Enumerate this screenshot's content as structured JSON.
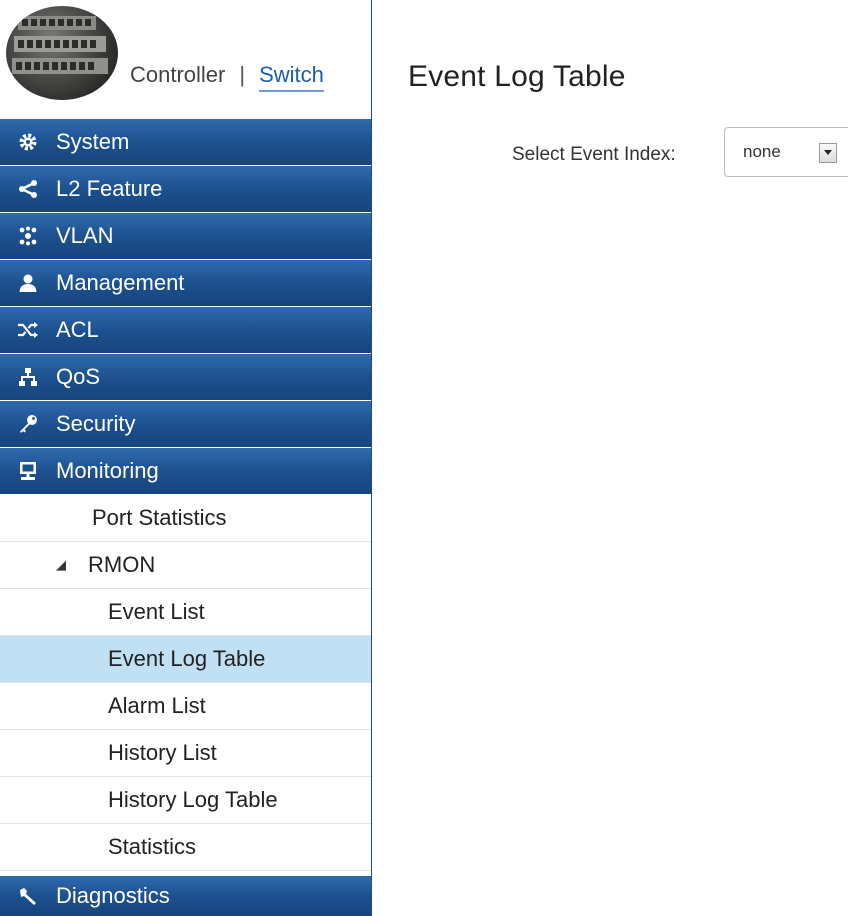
{
  "header": {
    "controller_label": "Controller",
    "separator": "|",
    "switch_label": "Switch"
  },
  "nav": {
    "system": "System",
    "l2": "L2 Feature",
    "vlan": "VLAN",
    "management": "Management",
    "acl": "ACL",
    "qos": "QoS",
    "security": "Security",
    "monitoring": "Monitoring",
    "diagnostics": "Diagnostics"
  },
  "monitoring_sub": {
    "port_statistics": "Port Statistics",
    "rmon": "RMON",
    "rmon_items": {
      "event_list": "Event List",
      "event_log_table": "Event Log Table",
      "alarm_list": "Alarm List",
      "history_list": "History List",
      "history_log_table": "History Log Table",
      "statistics": "Statistics"
    }
  },
  "main": {
    "title": "Event Log Table",
    "event_index_label": "Select Event Index:",
    "event_index_value": "none"
  },
  "colors": {
    "nav_bg": "#1c4f8d",
    "active_bg": "#c2e0f4",
    "link": "#1d5fa6"
  },
  "icons": {
    "system": "gear-icon",
    "l2": "share-icon",
    "vlan": "network-icon",
    "management": "user-icon",
    "acl": "shuffle-icon",
    "qos": "sitemap-icon",
    "security": "key-icon",
    "monitoring": "monitor-icon",
    "diagnostics": "wrench-icon",
    "rmon": "expand-triangle-icon",
    "select": "dropdown-arrow-icon"
  }
}
